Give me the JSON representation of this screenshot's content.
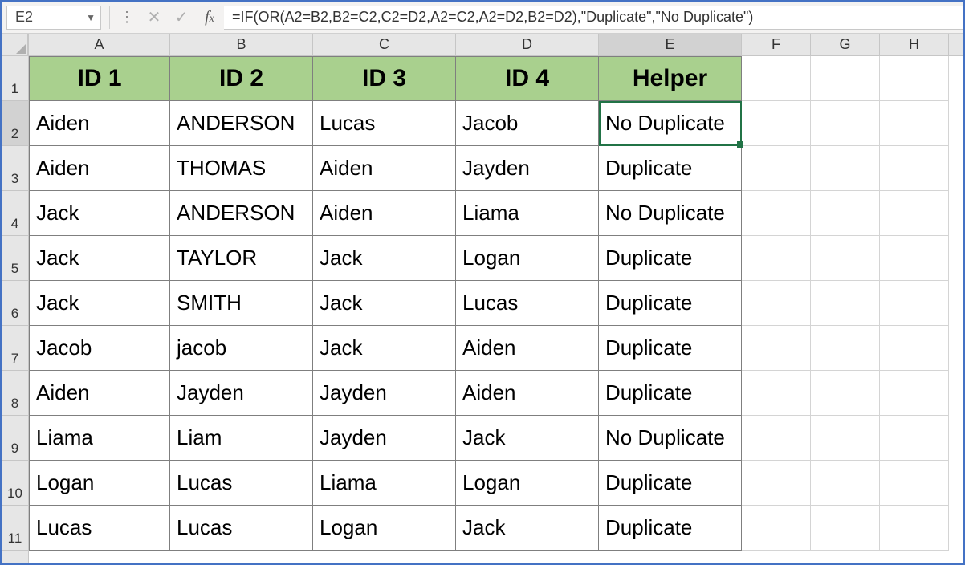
{
  "namebox": "E2",
  "formula": "=IF(OR(A2=B2,B2=C2,C2=D2,A2=C2,A2=D2,B2=D2),\"Duplicate\",\"No Duplicate\")",
  "columns": [
    "A",
    "B",
    "C",
    "D",
    "E",
    "F",
    "G",
    "H"
  ],
  "row_labels": [
    "1",
    "2",
    "3",
    "4",
    "5",
    "6",
    "7",
    "8",
    "9",
    "10",
    "11"
  ],
  "headers": [
    "ID 1",
    "ID 2",
    "ID 3",
    "ID 4",
    "Helper"
  ],
  "rows": [
    [
      "Aiden",
      "ANDERSON",
      "Lucas",
      "Jacob",
      "No Duplicate"
    ],
    [
      "Aiden",
      "THOMAS",
      "Aiden",
      "Jayden",
      "Duplicate"
    ],
    [
      "Jack",
      "ANDERSON",
      "Aiden",
      "Liama",
      "No Duplicate"
    ],
    [
      "Jack",
      "TAYLOR",
      "Jack",
      "Logan",
      "Duplicate"
    ],
    [
      "Jack",
      "SMITH",
      "Jack",
      "Lucas",
      "Duplicate"
    ],
    [
      "Jacob",
      "jacob",
      "Jack",
      "Aiden",
      "Duplicate"
    ],
    [
      "Aiden",
      "Jayden",
      "Jayden",
      "Aiden",
      "Duplicate"
    ],
    [
      "Liama",
      "Liam",
      "Jayden",
      "Jack",
      "No Duplicate"
    ],
    [
      "Logan",
      "Lucas",
      "Liama",
      "Logan",
      "Duplicate"
    ],
    [
      "Lucas",
      "Lucas",
      "Logan",
      "Jack",
      "Duplicate"
    ]
  ],
  "selected_cell": {
    "row": 2,
    "col": "E"
  }
}
